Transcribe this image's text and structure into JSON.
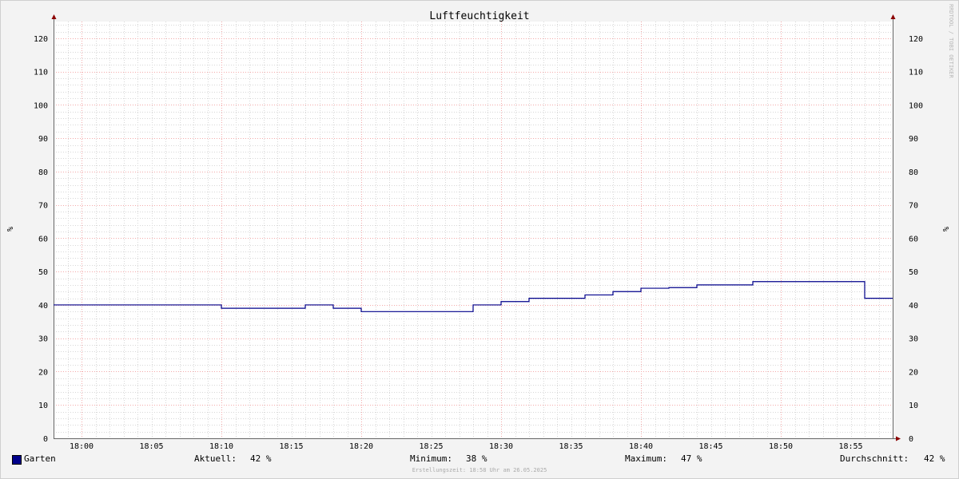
{
  "watermark": "RRDTOOL / TOBI OETIKER",
  "colors": {
    "background": "#f3f3f3",
    "plot_background": "#ffffff",
    "major_grid": "#f3a9a9",
    "minor_grid": "#d7d7d7",
    "series": "#00008b",
    "axis": "#666666",
    "arrow": "#8b0000"
  },
  "legend": {
    "series_name": "Garten",
    "current_label": "Aktuell:",
    "current_value": "42 %",
    "min_label": "Minimum:",
    "min_value": "38 %",
    "max_label": "Maximum:",
    "max_value": "47 %",
    "avg_label": "Durchschnitt:",
    "avg_value": "42 %"
  },
  "footer": "Erstellungszeit: 18:58 Uhr am 26.05.2025",
  "chart_data": {
    "type": "line",
    "title": "Luftfeuchtigkeit",
    "ylabel": "%",
    "ylabel_right": "%",
    "xlabel": "",
    "ylim": [
      0,
      125
    ],
    "yticks": [
      0,
      10,
      20,
      30,
      40,
      50,
      60,
      70,
      80,
      90,
      100,
      110,
      120
    ],
    "x_range": [
      "17:58",
      "18:58"
    ],
    "xticks": [
      "18:00",
      "18:05",
      "18:10",
      "18:15",
      "18:20",
      "18:25",
      "18:30",
      "18:35",
      "18:40",
      "18:45",
      "18:50",
      "18:55"
    ],
    "grid": true,
    "legend_position": "bottom",
    "series": [
      {
        "name": "Garten",
        "step": true,
        "points": [
          [
            "17:58",
            40
          ],
          [
            "18:10",
            39
          ],
          [
            "18:16",
            40
          ],
          [
            "18:18",
            39
          ],
          [
            "18:20",
            38
          ],
          [
            "18:28",
            40
          ],
          [
            "18:30",
            41
          ],
          [
            "18:32",
            42
          ],
          [
            "18:36",
            43
          ],
          [
            "18:38",
            44
          ],
          [
            "18:40",
            45
          ],
          [
            "18:42",
            45.2
          ],
          [
            "18:44",
            46
          ],
          [
            "18:48",
            47
          ],
          [
            "18:56",
            42
          ],
          [
            "18:58",
            42
          ]
        ]
      }
    ]
  }
}
